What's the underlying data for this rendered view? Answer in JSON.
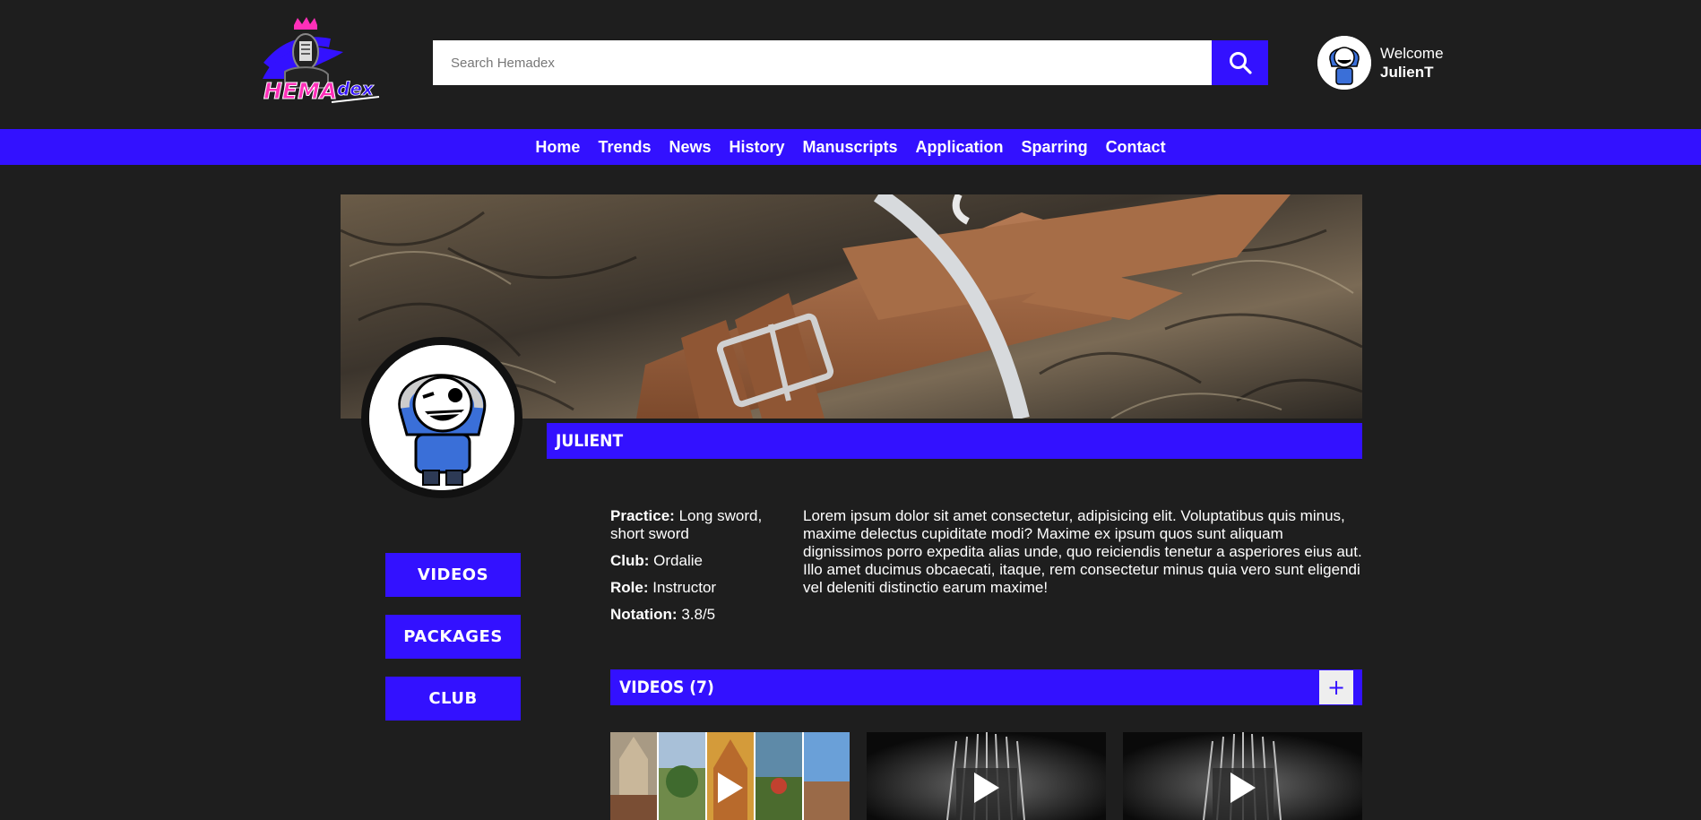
{
  "brand": {
    "logo_text_main": "HEMA",
    "logo_text_sub": "dex",
    "accent": "#3311ff",
    "pink": "#ff2fb9"
  },
  "search": {
    "placeholder": "Search Hemadex",
    "icon": "search-icon"
  },
  "user": {
    "greeting": "Welcome",
    "name": "JulienT"
  },
  "nav": [
    "Home",
    "Trends",
    "News",
    "History",
    "Manuscripts",
    "Application",
    "Sparring",
    "Contact"
  ],
  "profile": {
    "display_name": "JULIENT",
    "info": [
      {
        "key": "Practice:",
        "value": "Long sword, short sword"
      },
      {
        "key": "Club:",
        "value": "Ordalie"
      },
      {
        "key": "Role:",
        "value": "Instructor"
      },
      {
        "key": "Notation:",
        "value": "3.8/5"
      }
    ],
    "bio": "Lorem ipsum dolor sit amet consectetur, adipisicing elit. Voluptatibus quis minus, maxime delectus cupiditate modi? Maxime ex ipsum quos sunt aliquam dignissimos porro expedita alias unde, quo reiciendis tenetur a asperiores eius aut. Illo amet ducimus obcaecati, itaque, rem consectetur minus quia vero sunt eligendi vel deleniti distinctio earum maxime!"
  },
  "sidebar": [
    "VIDEOS",
    "PACKAGES",
    "CLUB"
  ],
  "videos": {
    "title": "VIDEOS (7)",
    "add_label": "+"
  }
}
